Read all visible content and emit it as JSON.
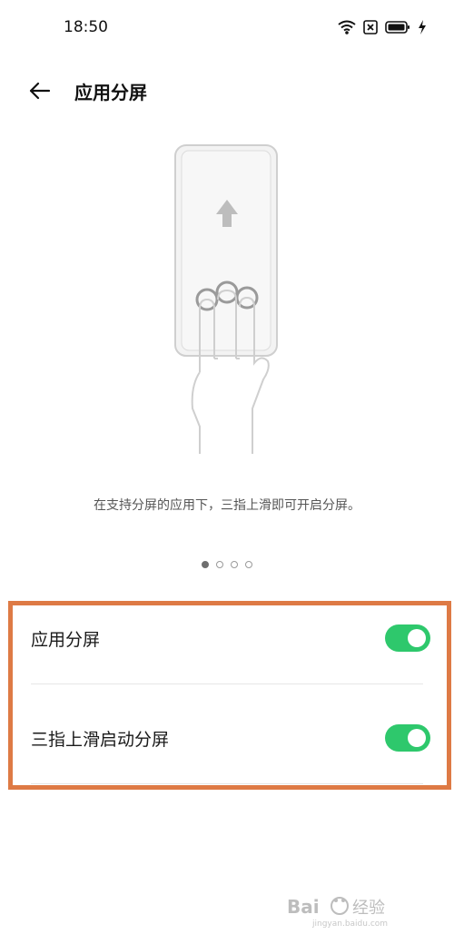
{
  "status_bar": {
    "time": "18:50",
    "icons": [
      "wifi-icon",
      "sim-disabled-icon",
      "battery-icon",
      "charging-bolt-icon"
    ]
  },
  "header": {
    "back_icon": "back-arrow-icon",
    "title": "应用分屏"
  },
  "illustration": {
    "description": "在支持分屏的应用下，三指上滑即可开启分屏。"
  },
  "pager": {
    "count": 4,
    "active_index": 0
  },
  "settings": [
    {
      "label": "应用分屏",
      "enabled": true
    },
    {
      "label": "三指上滑启动分屏",
      "enabled": true
    }
  ],
  "colors": {
    "toggle_on": "#2ec86c",
    "highlight_border": "#de7a45"
  }
}
